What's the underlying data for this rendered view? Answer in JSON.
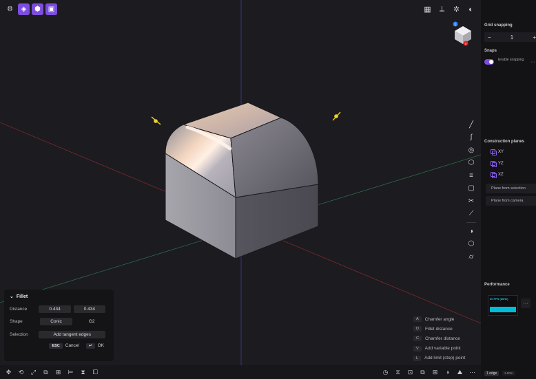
{
  "toolbar": {
    "left_icons": [
      "settings-icon",
      "solid-icon",
      "cube-icon",
      "box-icon"
    ],
    "right_icons": [
      "grid-icon",
      "axis-icon",
      "aperture-icon",
      "render-mode-icon"
    ]
  },
  "view_cube": {
    "top_label": "Z",
    "bottom_label": "X"
  },
  "tools": [
    "line-icon",
    "spline-icon",
    "circle-icon",
    "polygon-icon",
    "extrude-icon",
    "rectangle-icon",
    "cut-icon",
    "trim-icon",
    "shell-icon",
    "cube-icon",
    "cylinder-icon"
  ],
  "fillet_panel": {
    "title": "Fillet",
    "distance_label": "Distance",
    "distance_1": "0.434",
    "distance_2": "0.434",
    "shape_label": "Shape",
    "shape_value": "Conic",
    "shape_continuity": "G2",
    "selection_label": "Selection",
    "selection_button": "Add tangent edges",
    "cancel_key": "ESC",
    "cancel_label": "Cancel",
    "ok_key": "↵",
    "ok_label": "OK"
  },
  "hints": [
    {
      "key": "A",
      "label": "Chamfer angle"
    },
    {
      "key": "D",
      "label": "Fillet distance"
    },
    {
      "key": "C",
      "label": "Chamfer distance"
    },
    {
      "key": "V",
      "label": "Add variable point"
    },
    {
      "key": "L",
      "label": "Add limit (stop) point"
    }
  ],
  "right_panel": {
    "grid_snapping_title": "Grid snapping",
    "grid_value": "1",
    "minus": "−",
    "plus": "+",
    "snaps_title": "Snaps",
    "enable_snapping": "Enable snapping",
    "more": "···",
    "construction_planes_title": "Construction planes",
    "planes": [
      "XY",
      "YZ",
      "XZ"
    ],
    "plane_from_selection": "Plane from selection",
    "plane_from_camera": "Plane from camera",
    "performance_title": "Performance",
    "perf_label": "60 FPS (60Hz)",
    "selection_badge": "1 edge",
    "units_badge": "1.00m"
  },
  "colors": {
    "accent": "#7c4dde",
    "perf": "#00bcd4"
  }
}
